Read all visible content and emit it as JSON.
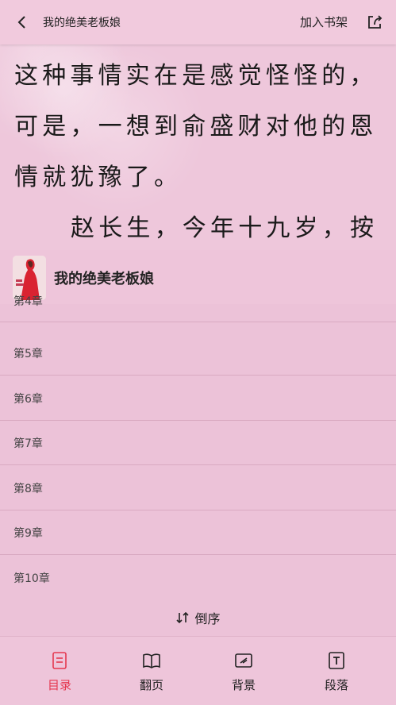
{
  "topbar": {
    "title": "我的绝美老板娘",
    "add_to_shelf": "加入书架",
    "back_icon": "chevron-left-icon",
    "share_icon": "share-icon"
  },
  "reader": {
    "lines": [
      "这种事情实在是感觉怪怪的，",
      "可是，一想到俞盛财对他的恩",
      "情就犹豫了。",
      "赵长生，今年十九岁，按"
    ]
  },
  "toc": {
    "book_title": "我的绝美老板娘",
    "chapters": [
      "第4章",
      "第5章",
      "第6章",
      "第7章",
      "第8章",
      "第9章",
      "第10章"
    ],
    "sort_label": "倒序",
    "sort_icon": "sort-arrows-icon"
  },
  "bottom_nav": {
    "items": [
      {
        "label": "目录",
        "icon": "list-icon",
        "active": true
      },
      {
        "label": "翻页",
        "icon": "book-open-icon",
        "active": false
      },
      {
        "label": "背景",
        "icon": "background-icon",
        "active": false
      },
      {
        "label": "段落",
        "icon": "text-format-icon",
        "active": false
      }
    ]
  },
  "colors": {
    "accent": "#e5374f",
    "background": "#eec7db"
  }
}
